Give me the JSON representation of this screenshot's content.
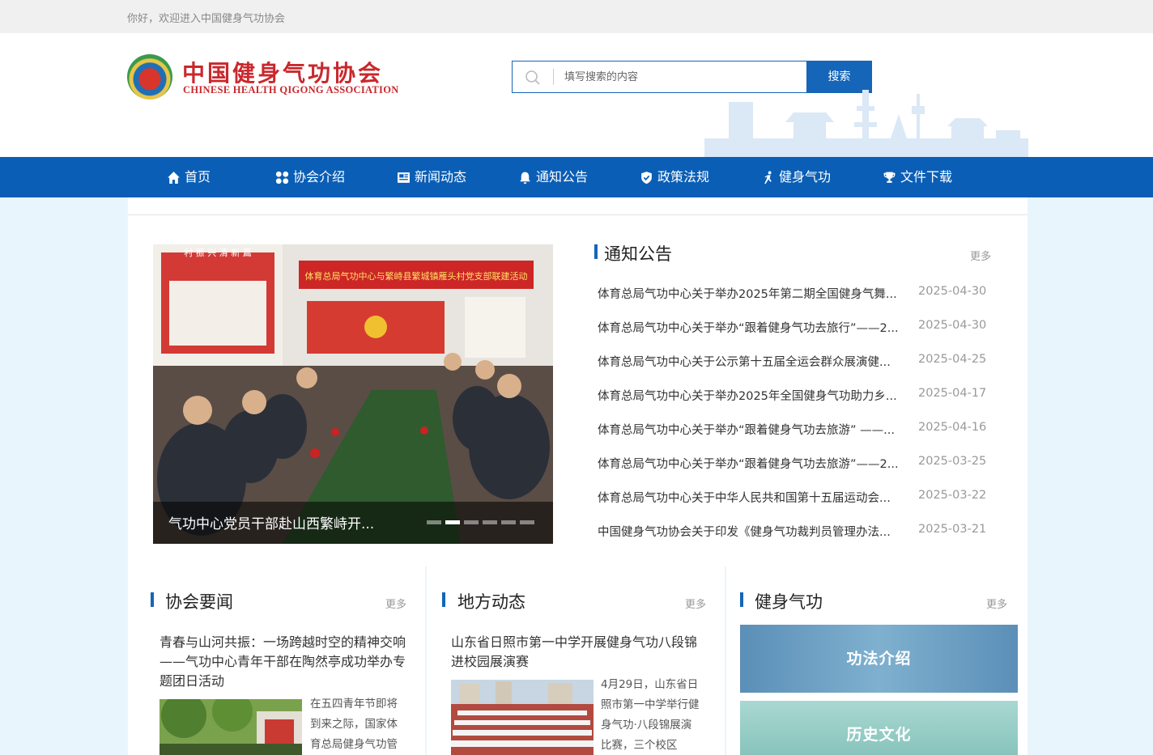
{
  "topbar": {
    "greeting": "你好，欢迎进入中国健身气功协会"
  },
  "logo": {
    "cn": "中国健身气功协会",
    "en": "CHINESE HEALTH QIGONG ASSOCIATION"
  },
  "search": {
    "placeholder": "填写搜索的内容",
    "button": "搜索"
  },
  "nav": [
    {
      "label": "首页",
      "icon": "home-icon"
    },
    {
      "label": "协会介绍",
      "icon": "grid-icon"
    },
    {
      "label": "新闻动态",
      "icon": "news-icon"
    },
    {
      "label": "通知公告",
      "icon": "bell-icon"
    },
    {
      "label": "政策法规",
      "icon": "shield-icon"
    },
    {
      "label": "健身气功",
      "icon": "exercise-icon"
    },
    {
      "label": "文件下载",
      "icon": "trophy-icon"
    }
  ],
  "slider": {
    "caption": "气功中心党员干部赴山西繁峙开...",
    "banner_text": "体育总局气功中心与繁峙县繁城镇雁头村党支部联建活动",
    "wall_slogan": "村 振 兴 清 新 篇",
    "slide_count": 6,
    "active_index": 1
  },
  "notices": {
    "title": "通知公告",
    "more": "更多",
    "items": [
      {
        "title": "体育总局气功中心关于举办2025年第二期全国健身气舞...",
        "date": "2025-04-30"
      },
      {
        "title": "体育总局气功中心关于举办“跟着健身气功去旅行”——2...",
        "date": "2025-04-30"
      },
      {
        "title": "体育总局气功中心关于公示第十五届全运会群众展演健...",
        "date": "2025-04-25"
      },
      {
        "title": "体育总局气功中心关于举办2025年全国健身气功助力乡...",
        "date": "2025-04-17"
      },
      {
        "title": "体育总局气功中心关于举办“跟着健身气功去旅游” ——...",
        "date": "2025-04-16"
      },
      {
        "title": "体育总局气功中心关于举办“跟着健身气功去旅游”——2...",
        "date": "2025-03-25"
      },
      {
        "title": "体育总局气功中心关于中华人民共和国第十五届运动会...",
        "date": "2025-03-22"
      },
      {
        "title": "中国健身气功协会关于印发《健身气功裁判员管理办法...",
        "date": "2025-03-21"
      }
    ]
  },
  "association_news": {
    "title": "协会要闻",
    "more": "更多",
    "headline": "青春与山河共振：一场跨越时空的精神交响——气功中心青年干部在陶然亭成功举办专题团日活动",
    "summary": "在五四青年节即将到来之际，国家体育总局健身气功管"
  },
  "local_news": {
    "title": "地方动态",
    "more": "更多",
    "headline": "山东省日照市第一中学开展健身气功八段锦进校园展演赛",
    "summary": "4月29日，山东省日照市第一中学举行健身气功·八段锦展演比赛，三个校区"
  },
  "qigong": {
    "title": "健身气功",
    "more": "更多",
    "banners": [
      "功法介绍",
      "历史文化"
    ]
  },
  "colors": {
    "primary": "#0a5eb5",
    "brand_red": "#c9282d",
    "page_bg": "#e9f5fd"
  }
}
